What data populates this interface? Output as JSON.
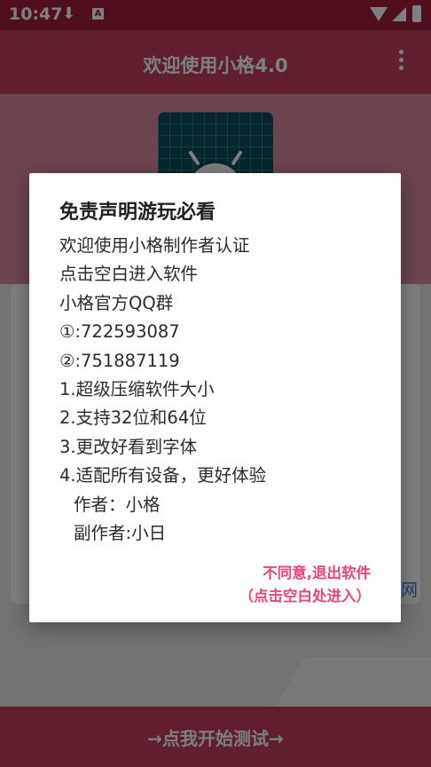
{
  "status_bar": {
    "time": "10:47",
    "download_icon": "download-icon",
    "notification_icon": "a-notification-icon",
    "wifi_icon": "wifi-icon",
    "signal_icon": "signal-icon",
    "battery_icon": "battery-charging-icon"
  },
  "toolbar": {
    "title": "欢迎使用小格4.0",
    "menu_icon": "more-vert-icon"
  },
  "background": {
    "app_icon": "android-icon",
    "side_link_text": "网",
    "bottom_button_label": "→点我开始测试→"
  },
  "dialog": {
    "title": "免责声明游玩必看",
    "lines": [
      "欢迎使用小格制作者认证",
      "点击空白进入软件",
      "小格官方QQ群",
      "①:722593087",
      "②:751887119",
      "1.超级压缩软件大小",
      "2.支持32位和64位",
      "3.更改好看到字体",
      "4.适配所有设备，更好体验",
      "作者：小格",
      "副作者:小日"
    ],
    "disagree_label": "不同意,退出软件",
    "enter_hint": "（点击空白处进入）"
  },
  "colors": {
    "status_bar": "#a11f3a",
    "toolbar": "#c23d58",
    "accent_action": "#e8457a",
    "dialog_bg": "#ffffff"
  }
}
